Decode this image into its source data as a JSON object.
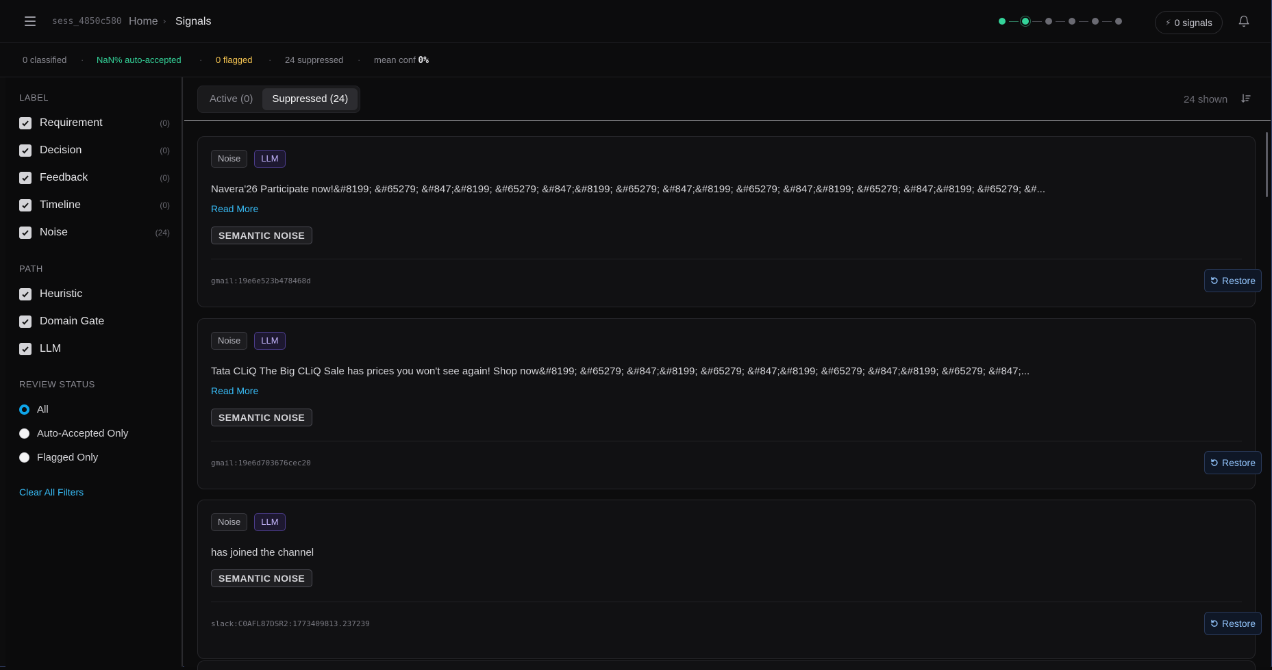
{
  "header": {
    "session_id": "sess_4850c580",
    "breadcrumb": [
      "Home",
      "Signals"
    ],
    "breadcrumb_sep": "›",
    "pipeline_steps": [
      {
        "state": "done"
      },
      {
        "state": "current"
      },
      {
        "state": "pending"
      },
      {
        "state": "pending"
      },
      {
        "state": "pending"
      },
      {
        "state": "pending"
      }
    ],
    "signals_button": "0 signals",
    "icons": {
      "menu": "hamburger-menu-icon",
      "signals": "bolt-icon",
      "notifications": "bell-icon"
    }
  },
  "stats": {
    "classified": "0 classified",
    "auto_accepted": "NaN% auto-accepted",
    "flagged": "0 flagged",
    "suppressed": "24 suppressed",
    "mean_conf_label": "mean conf",
    "mean_conf_value": "0%",
    "separator": "·"
  },
  "sidebar": {
    "label_title": "LABEL",
    "labels": [
      {
        "name": "Requirement",
        "count": "(0)",
        "checked": true
      },
      {
        "name": "Decision",
        "count": "(0)",
        "checked": true
      },
      {
        "name": "Feedback",
        "count": "(0)",
        "checked": true
      },
      {
        "name": "Timeline",
        "count": "(0)",
        "checked": true
      },
      {
        "name": "Noise",
        "count": "(24)",
        "checked": true
      }
    ],
    "path_title": "PATH",
    "paths": [
      {
        "name": "Heuristic",
        "checked": true
      },
      {
        "name": "Domain Gate",
        "checked": true
      },
      {
        "name": "LLM",
        "checked": true
      }
    ],
    "review_title": "REVIEW STATUS",
    "review_options": [
      {
        "name": "All",
        "selected": true
      },
      {
        "name": "Auto-Accepted Only",
        "selected": false
      },
      {
        "name": "Flagged Only",
        "selected": false
      }
    ],
    "clear_filters": "Clear All Filters"
  },
  "main": {
    "tabs": [
      {
        "label": "Active (0)",
        "active": false
      },
      {
        "label": "Suppressed (24)",
        "active": true
      }
    ],
    "shown_count": "24 shown",
    "sort_icon": "sort-descending-icon",
    "cards": [
      {
        "tags": [
          "Noise",
          "LLM"
        ],
        "text": "Navera'26 Participate now!&#8199; &#65279; &#847;&#8199; &#65279; &#847;&#8199; &#65279; &#847;&#8199; &#65279; &#847;&#8199; &#65279; &#847;&#8199; &#65279; &#...",
        "read_more": "Read More",
        "badge": "SEMANTIC NOISE",
        "source": "gmail:19e6e523b478468d",
        "action": "Restore"
      },
      {
        "tags": [
          "Noise",
          "LLM"
        ],
        "text": "Tata CLiQ The Big CLiQ Sale has prices you won't see again! Shop now&#8199; &#65279; &#847;&#8199; &#65279; &#847;&#8199; &#65279; &#847;&#8199; &#65279; &#847;...",
        "read_more": "Read More",
        "badge": "SEMANTIC NOISE",
        "source": "gmail:19e6d703676cec20",
        "action": "Restore"
      },
      {
        "tags": [
          "Noise",
          "LLM"
        ],
        "text": "has joined the channel",
        "read_more": "",
        "badge": "SEMANTIC NOISE",
        "source": "slack:C0AFL87DSR2:1773409813.237239",
        "action": "Restore"
      }
    ]
  },
  "colors": {
    "accent_green": "#34d399",
    "accent_amber": "#f5c451",
    "link_blue": "#38bdf8",
    "llm_purple": "#c4b5fd"
  }
}
